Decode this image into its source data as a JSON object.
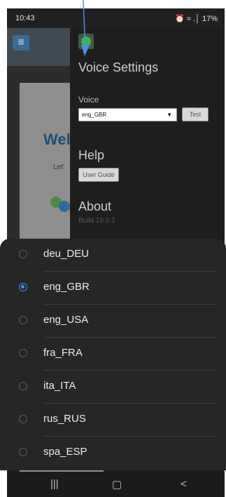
{
  "status": {
    "time": "10:43",
    "left_icons": "▧ ◎",
    "right_text": "⏰ ≈ .│ 17%"
  },
  "background": {
    "welcome": "Wel",
    "lets": "Let'"
  },
  "drawer": {
    "voice_settings": "Voice Settings",
    "voice_label": "Voice",
    "selected_voice": "eng_GBR",
    "test_label": "Test",
    "help_title": "Help",
    "user_guide_label": "User Guide",
    "about_title": "About",
    "build": "Build 16.0.2"
  },
  "options": [
    {
      "label": "deu_DEU",
      "selected": false
    },
    {
      "label": "eng_GBR",
      "selected": true
    },
    {
      "label": "eng_USA",
      "selected": false
    },
    {
      "label": "fra_FRA",
      "selected": false
    },
    {
      "label": "ita_ITA",
      "selected": false
    },
    {
      "label": "rus_RUS",
      "selected": false
    },
    {
      "label": "spa_ESP",
      "selected": false
    }
  ],
  "colors": {
    "accent": "#3f8cff",
    "sheet": "#262626"
  },
  "nav": {
    "recents": "|||",
    "home": "▢",
    "back": "<"
  }
}
